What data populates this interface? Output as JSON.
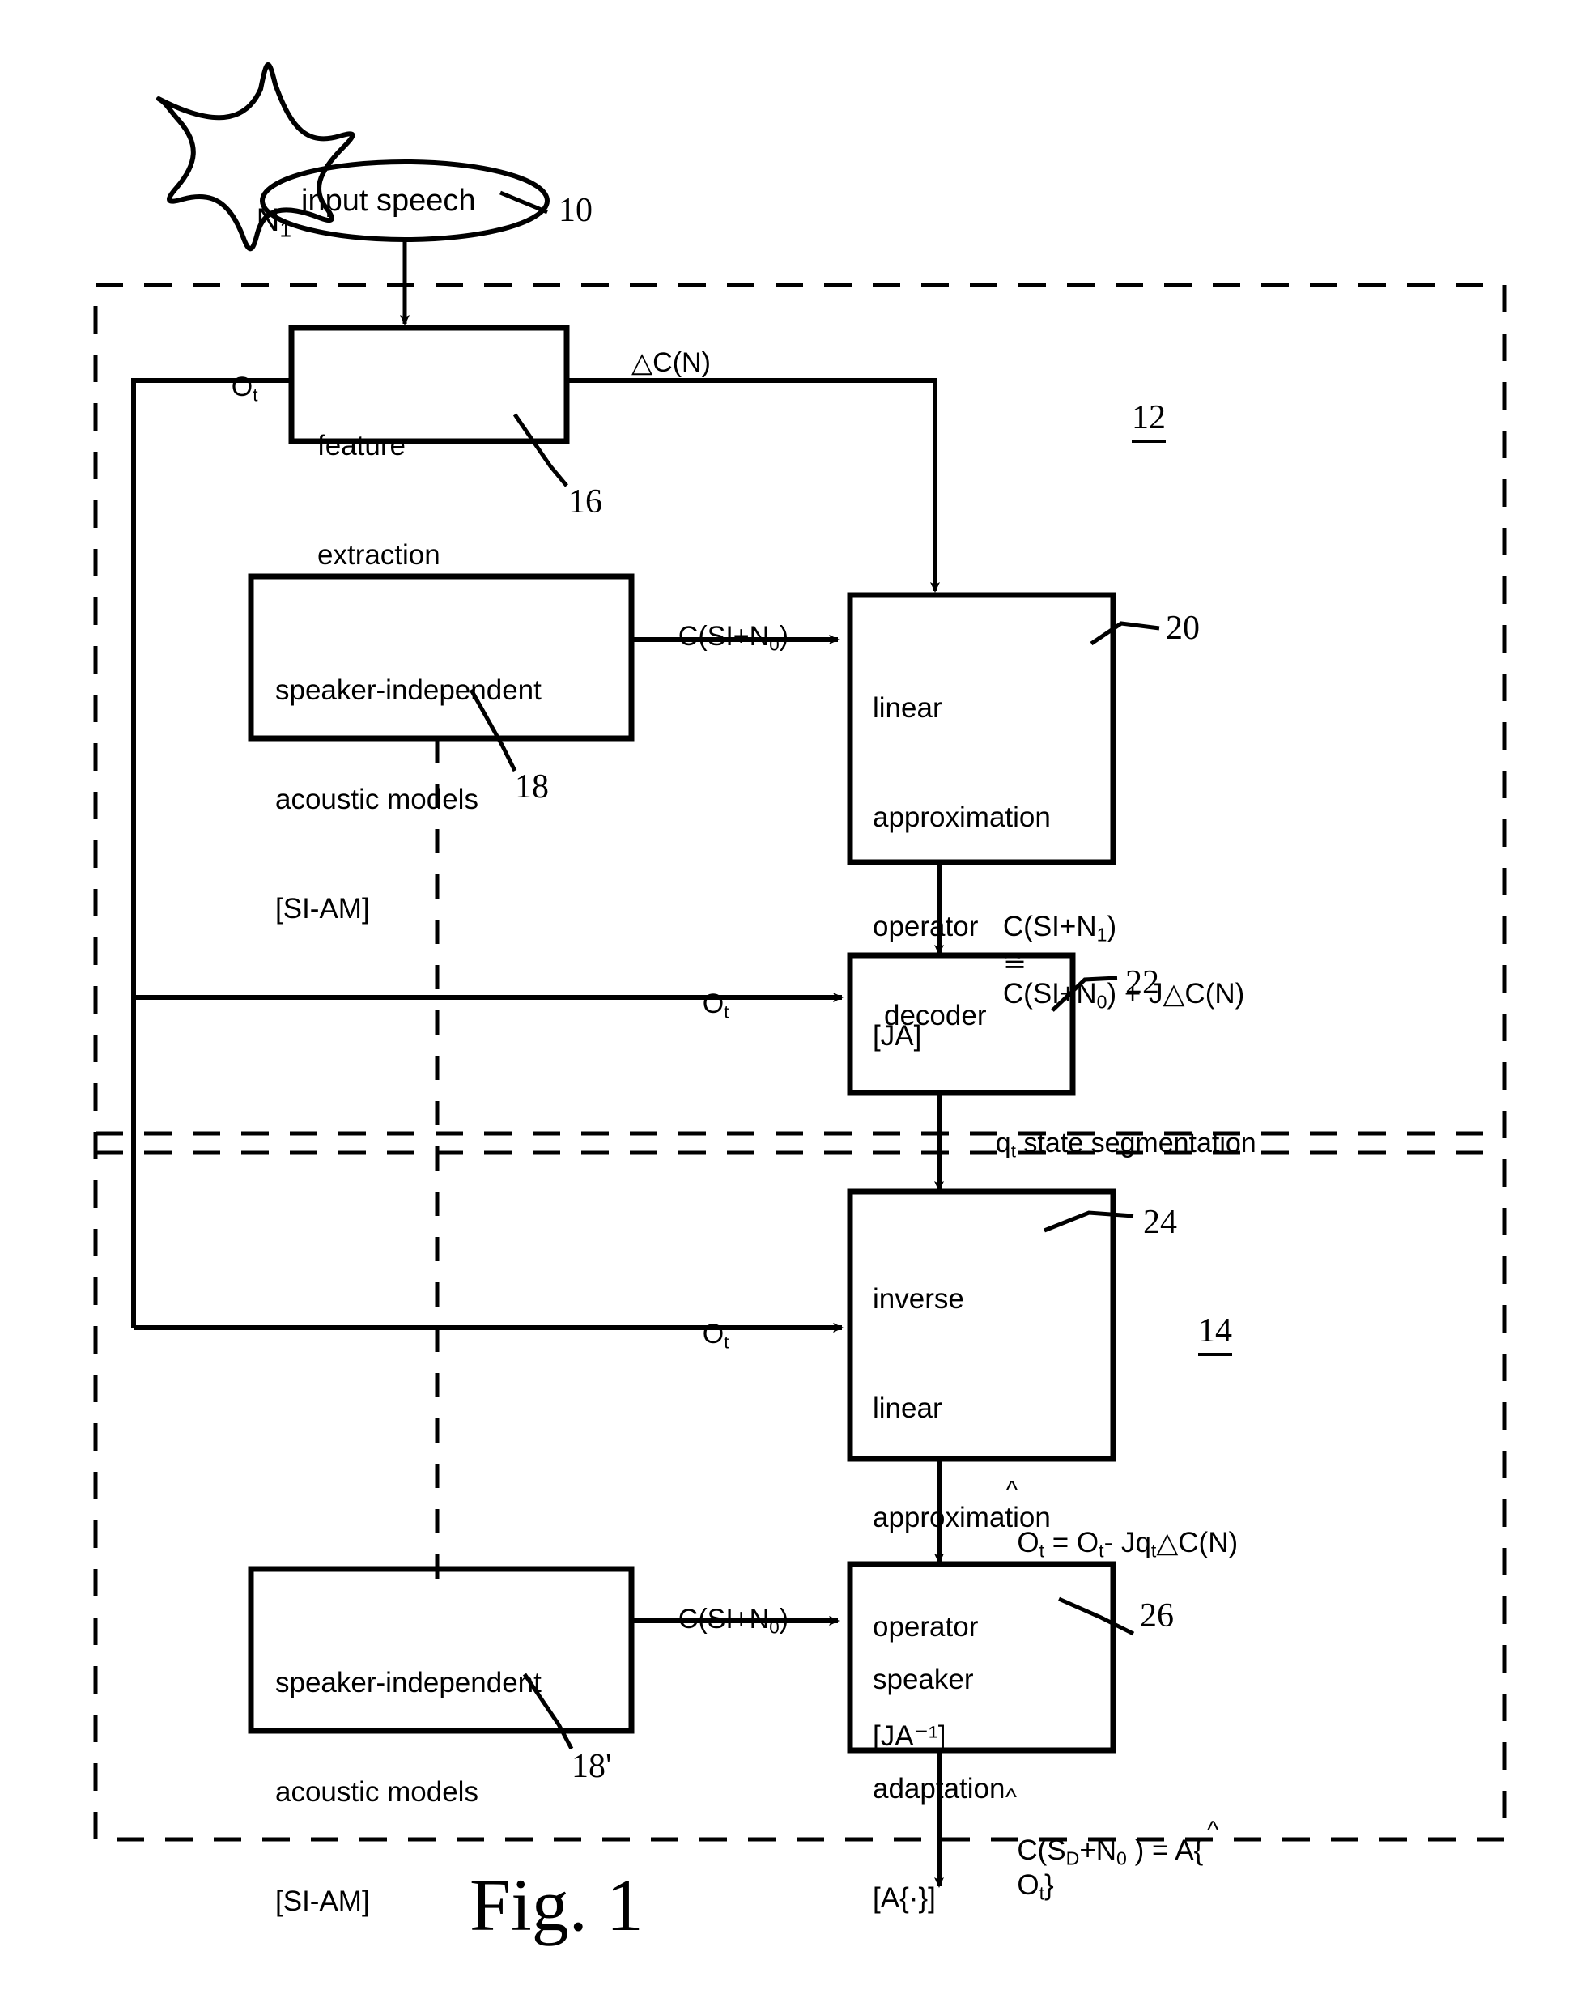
{
  "figure": {
    "caption": "Fig. 1",
    "noise_label": "N₁",
    "input_node_label": "input speech",
    "input_ref": "10",
    "region_upper_ref": "12",
    "region_lower_ref": "14"
  },
  "blocks": [
    {
      "id": "feature-extraction",
      "lines": [
        "feature",
        "extraction"
      ],
      "ref": "16"
    },
    {
      "id": "si-am-upper",
      "lines": [
        "speaker-independent",
        "acoustic models",
        "[SI-AM]"
      ],
      "ref": "18"
    },
    {
      "id": "linear-approximation-operator",
      "lines": [
        "linear",
        "approximation",
        "operator",
        "[JA]"
      ],
      "ref": "20"
    },
    {
      "id": "decoder",
      "lines": [
        "decoder"
      ],
      "ref": "22"
    },
    {
      "id": "inverse-linear-approximation-operator",
      "lines": [
        "inverse",
        "linear",
        "approximation",
        "operator",
        "[JA⁻¹]"
      ],
      "ref": "24"
    },
    {
      "id": "si-am-lower",
      "lines": [
        "speaker-independent",
        "acoustic models",
        "[SI-AM]"
      ],
      "ref": "18'"
    },
    {
      "id": "speaker-adaptation",
      "lines": [
        "speaker",
        "adaptation",
        "[A{·}]"
      ],
      "ref": "26"
    }
  ],
  "edge_labels": {
    "ot_feature_in": "O",
    "ot_sub": "t",
    "delta_c_n": "△C(N)",
    "c_si_n0_upper": "C(SI+N",
    "c_si_n0_upper_sub": "0",
    "c_si_n0_upper_tail": ")",
    "ot_decoder": "O",
    "ot_decoder_sub": "t",
    "qt_state": "state segmentation",
    "qt_prefix": "q",
    "qt_sub": "t",
    "ot_inverse": "O",
    "ot_inverse_sub": "t",
    "c_si_n0_lower": "C(SI+N",
    "c_si_n0_lower_sub": "0",
    "c_si_n0_lower_tail": ")"
  },
  "equations": {
    "approximation": "C(SI+N₁)  ≅  C(SI+N₀) + J△C(N)",
    "approximation_parts": {
      "lhs_c": "C(SI+N",
      "lhs_sub": "1",
      "lhs_close": ")",
      "op": "≅",
      "rhs_c": "C(SI+N",
      "rhs_sub": "0",
      "rhs_close": ") + J△C(N)"
    },
    "compensated_observation": "Ôt = Ot - Jqt △C(N)",
    "compensated_parts": {
      "o_hat": "O",
      "o_hat_sub": "t",
      "eq": " = O",
      "eq_sub": "t",
      "minus": "- Jq",
      "minus_sub": "t",
      "tail": "△C(N)"
    },
    "adapted_model": "Ĉ(SD+N0 ) = A{Ôt}",
    "adapted_parts": {
      "c_hat": "C(S",
      "c_sub_d": "D",
      "plus_n": "+N",
      "n_sub": "0",
      "close": " ) = A{",
      "o_hat": "O",
      "o_sub": "t",
      "end": "}"
    }
  }
}
